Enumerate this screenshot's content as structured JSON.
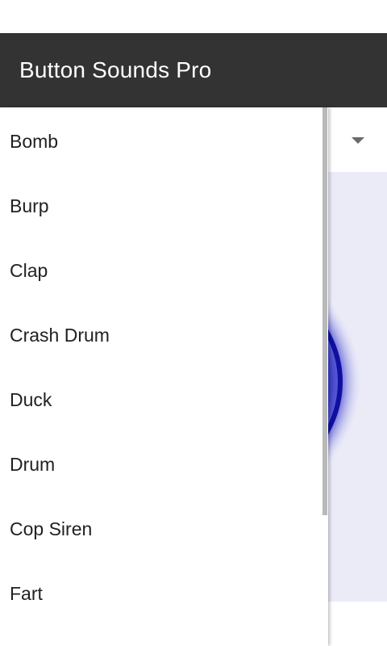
{
  "app": {
    "title": "Button Sounds Pro"
  },
  "sound_panel": {
    "accent_color": "#2a2ab8",
    "background_color": "#ebebf8"
  },
  "dropdown": {
    "items": [
      {
        "label": "Bomb"
      },
      {
        "label": "Burp"
      },
      {
        "label": "Clap"
      },
      {
        "label": "Crash Drum"
      },
      {
        "label": "Duck"
      },
      {
        "label": "Drum"
      },
      {
        "label": "Cop Siren"
      },
      {
        "label": "Fart"
      }
    ]
  },
  "icons": {
    "spinner": "chevron-down-icon"
  }
}
